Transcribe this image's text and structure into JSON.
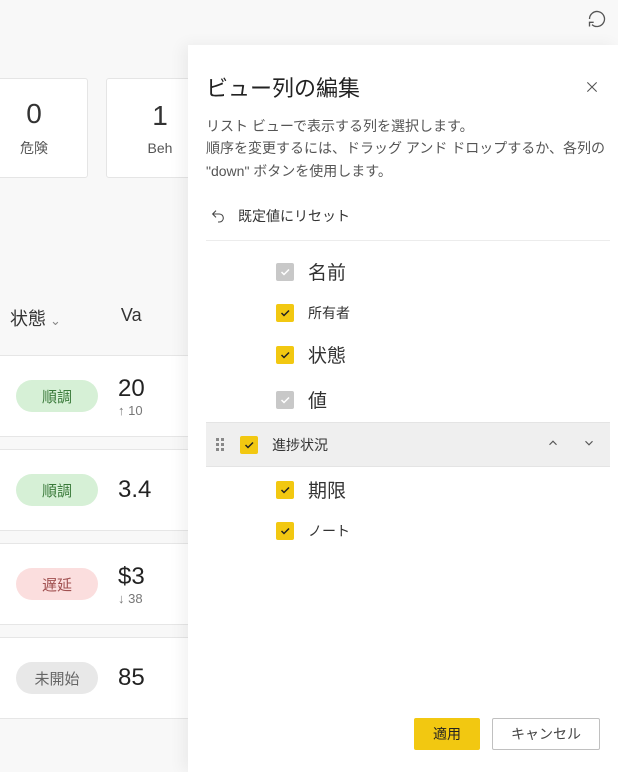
{
  "topbar": {
    "refresh_name": "refresh-icon"
  },
  "cards": [
    {
      "value": "0",
      "label": "危険"
    },
    {
      "value": "1",
      "label": "Beh"
    }
  ],
  "table": {
    "columns": [
      "状態",
      "Va"
    ],
    "rows": [
      {
        "status": "順調",
        "value": "20",
        "sub": "10",
        "color": "green",
        "dir": "up"
      },
      {
        "status": "順調",
        "value": "3.4",
        "sub": "",
        "color": "green",
        "dir": ""
      },
      {
        "status": "遅延",
        "value": "$3",
        "sub": "38",
        "color": "red",
        "dir": "dn"
      },
      {
        "status": "未開始",
        "value": "85",
        "sub": "",
        "color": "gray",
        "dir": ""
      }
    ]
  },
  "panel": {
    "title": "ビュー列の編集",
    "desc_line1": "リスト ビューで表示する列を選択します。",
    "desc_line2": "順序を変更するには、ドラッグ アンド ドロップするか、各列の \"down\" ボタンを使用します。",
    "reset_label": "既定値にリセット",
    "columns": [
      {
        "label": "名前",
        "checked": true,
        "locked": true,
        "active": false,
        "big": true
      },
      {
        "label": "所有者",
        "checked": true,
        "locked": false,
        "active": false,
        "big": false
      },
      {
        "label": "状態",
        "checked": true,
        "locked": false,
        "active": false,
        "big": true
      },
      {
        "label": "値",
        "checked": true,
        "locked": true,
        "active": false,
        "big": true
      },
      {
        "label": "進捗状況",
        "checked": true,
        "locked": false,
        "active": true,
        "big": false
      },
      {
        "label": "期限",
        "checked": true,
        "locked": false,
        "active": false,
        "big": true
      },
      {
        "label": "ノート",
        "checked": true,
        "locked": false,
        "active": false,
        "big": false
      }
    ],
    "apply_label": "適用",
    "cancel_label": "キャンセル"
  }
}
